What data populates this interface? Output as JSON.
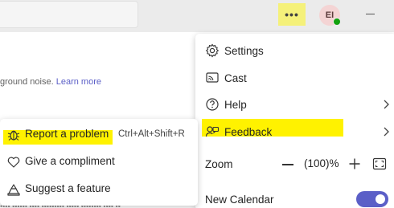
{
  "top_bar": {
    "more_label": "•••",
    "avatar_initials": "EI"
  },
  "background": {
    "partial_text": "ground noise.",
    "partial_link": "Learn more",
    "bottom_partial": "•••• •••••• •••• ••••••••• ••••• •••••••• •••• ••"
  },
  "menu": {
    "settings_label": "Settings",
    "cast_label": "Cast",
    "help_label": "Help",
    "feedback_label": "Feedback",
    "zoom_label": "Zoom",
    "zoom_value": "(100)%",
    "new_calendar_label": "New Calendar",
    "new_calendar_on": true
  },
  "feedback_submenu": {
    "report_label": "Report a problem",
    "report_shortcut": "Ctrl+Alt+Shift+R",
    "compliment_label": "Give a compliment",
    "suggest_label": "Suggest a feature"
  },
  "colors": {
    "highlight": "#fff200",
    "accent": "#5b5fc7",
    "presence": "#13a10e"
  }
}
